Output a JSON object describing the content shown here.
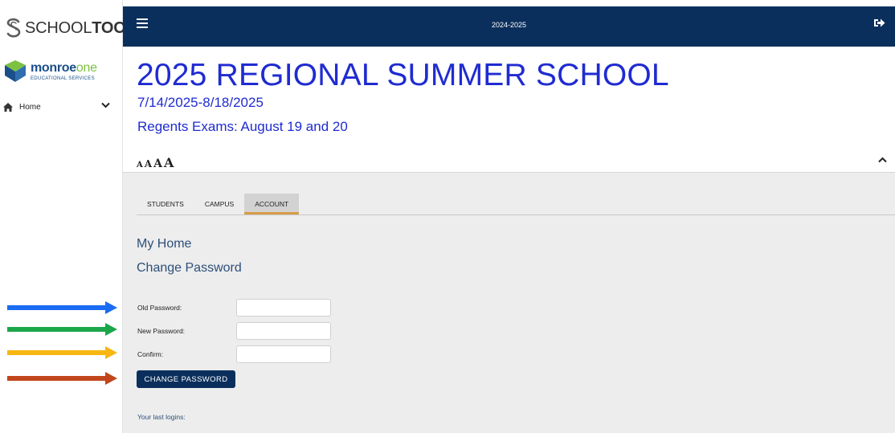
{
  "sidebar": {
    "logo_prefix": "SCHOOL",
    "logo_bold": "TOOL",
    "org_brand": "monroe",
    "org_brand_accent": "one",
    "org_sub": "EDUCATIONAL SERVICES",
    "nav_home_label": "Home"
  },
  "arrows": [
    {
      "color": "#1a6cf2"
    },
    {
      "color": "#1ca64a"
    },
    {
      "color": "#f7b711"
    },
    {
      "color": "#c1461b"
    }
  ],
  "topbar": {
    "year": "2024-2025",
    "bg_color": "#0b2f5c"
  },
  "header": {
    "school_name": "2025 REGIONAL SUMMER SCHOOL",
    "dates": "7/14/2025-8/18/2025",
    "regents": "Regents Exams:  August 19 and 20",
    "font_size_options": [
      "A",
      "A",
      "A",
      "A"
    ],
    "title_color": "#1f2bd1"
  },
  "tabs": [
    {
      "label": "STUDENTS",
      "active": false
    },
    {
      "label": "CAMPUS",
      "active": false
    },
    {
      "label": "ACCOUNT",
      "active": true
    }
  ],
  "main": {
    "my_home": "My Home",
    "change_password_title": "Change Password",
    "old_password_label": "Old Password:",
    "new_password_label": "New Password:",
    "confirm_label": "Confirm:",
    "old_password_value": "",
    "new_password_value": "",
    "confirm_value": "",
    "submit_label": "CHANGE PASSWORD",
    "last_logins_label": "Your last logins:"
  },
  "icons": {
    "menu": "hamburger-menu-icon",
    "logout": "sign-out-icon",
    "home": "home-icon",
    "chevron_down": "chevron-down-icon",
    "chevron_up": "chevron-up-icon"
  }
}
